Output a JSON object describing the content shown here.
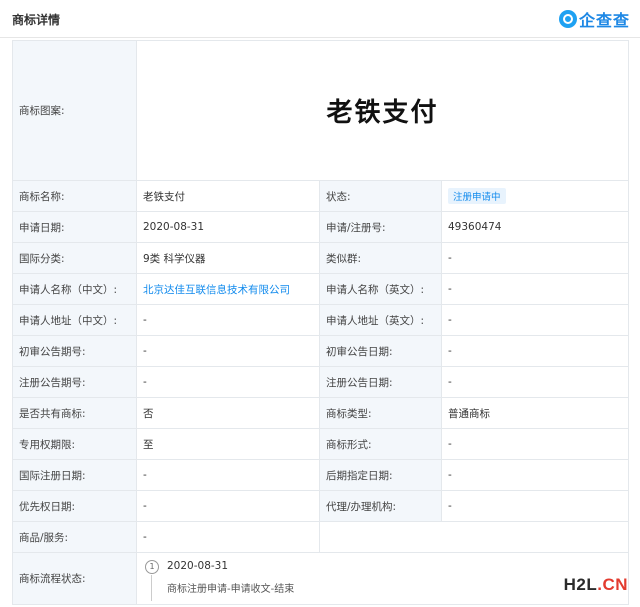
{
  "header": {
    "title": "商标详情",
    "brand": "企查查",
    "brand_icon": "qichacha-logo-icon"
  },
  "trademark": {
    "image_label": "商标图案:",
    "image_text": "老铁支付"
  },
  "rows": [
    {
      "l1": "商标名称:",
      "v1": "老铁支付",
      "l2": "状态:",
      "v2": "注册申请中"
    },
    {
      "l1": "申请日期:",
      "v1": "2020-08-31",
      "l2": "申请/注册号:",
      "v2": "49360474"
    },
    {
      "l1": "国际分类:",
      "v1": "9类 科学仪器",
      "l2": "类似群:",
      "v2": "-"
    },
    {
      "l1": "申请人名称（中文）:",
      "v1": "北京达佳互联信息技术有限公司",
      "l2": "申请人名称（英文）:",
      "v2": "-"
    },
    {
      "l1": "申请人地址（中文）:",
      "v1": "-",
      "l2": "申请人地址（英文）:",
      "v2": "-"
    },
    {
      "l1": "初审公告期号:",
      "v1": "-",
      "l2": "初审公告日期:",
      "v2": "-"
    },
    {
      "l1": "注册公告期号:",
      "v1": "-",
      "l2": "注册公告日期:",
      "v2": "-"
    },
    {
      "l1": "是否共有商标:",
      "v1": "否",
      "l2": "商标类型:",
      "v2": "普通商标"
    },
    {
      "l1": "专用权期限:",
      "v1": "至",
      "l2": "商标形式:",
      "v2": "-"
    },
    {
      "l1": "国际注册日期:",
      "v1": "-",
      "l2": "后期指定日期:",
      "v2": "-"
    },
    {
      "l1": "优先权日期:",
      "v1": "-",
      "l2": "代理/办理机构:",
      "v2": "-"
    }
  ],
  "goods": {
    "label": "商品/服务:",
    "value": "-"
  },
  "flow": {
    "label": "商标流程状态:",
    "step_number": "1",
    "date": "2020-08-31",
    "description": "商标注册申请-申请收文-结束"
  },
  "watermark": {
    "part1": "H2L",
    "part2": ".CN"
  },
  "colors": {
    "link": "#128bed",
    "label_bg": "#f3f7fb",
    "border": "#e4e8ec",
    "watermark_red": "#e33b2f"
  }
}
